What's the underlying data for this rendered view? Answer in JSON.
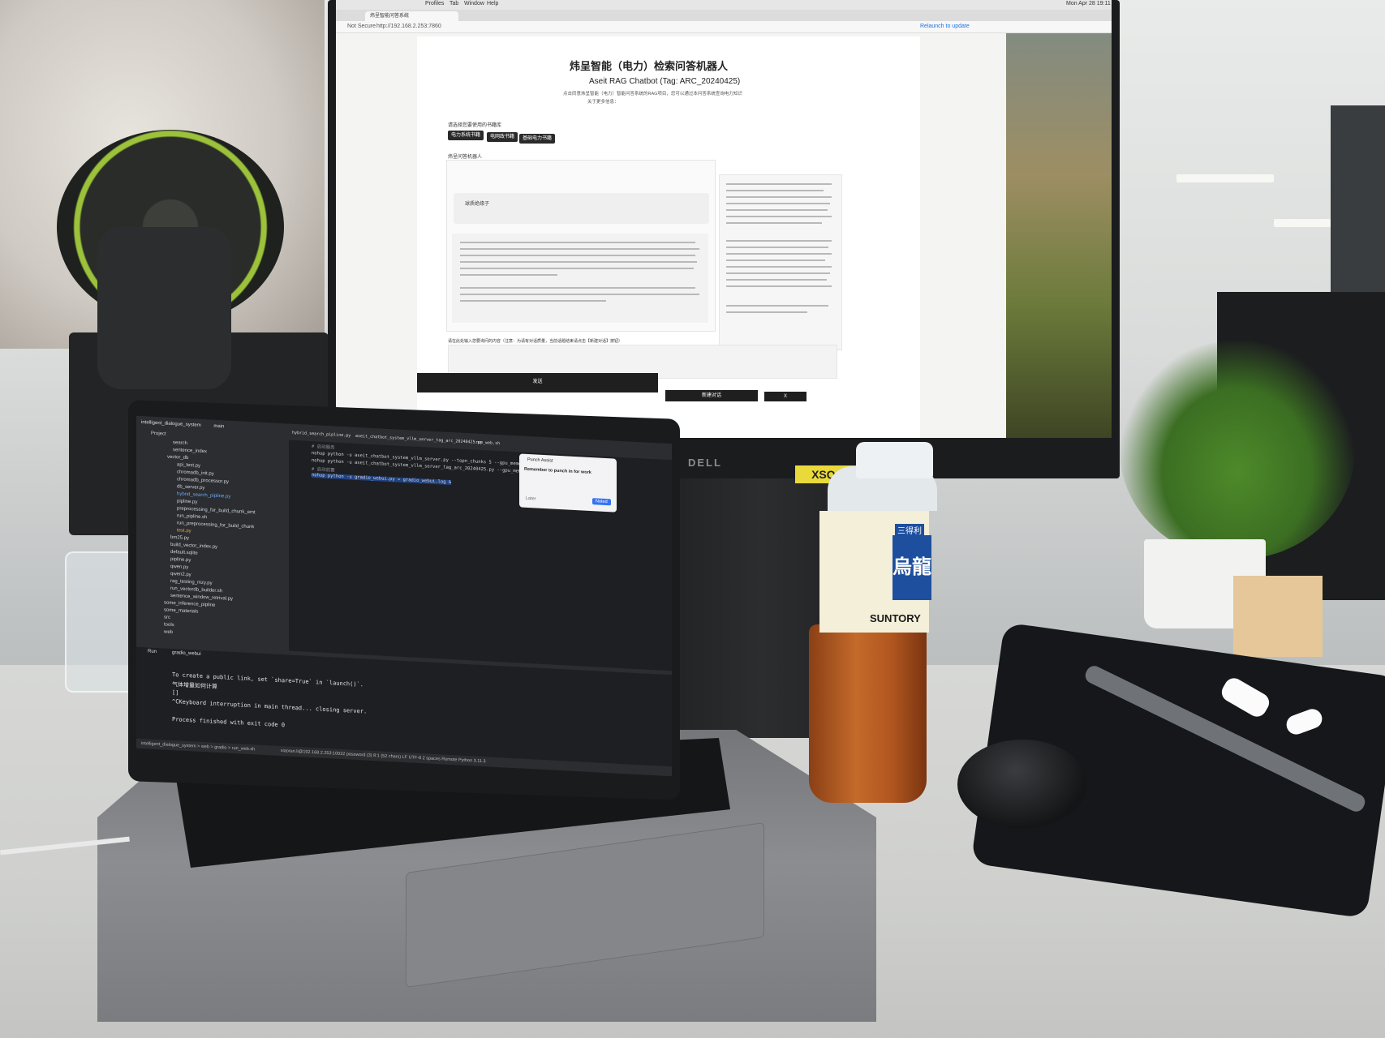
{
  "browser": {
    "menu_items": [
      "Profiles",
      "Tab",
      "Window",
      "Help"
    ],
    "tab_title": "炜呈智能问答系统",
    "not_secure": "Not Secure",
    "url": "http://192.168.2.253:7860",
    "relaunch": "Relaunch to update",
    "clock": "Mon Apr 28 19:11"
  },
  "app": {
    "title": "炜呈智能（电力）检索问答机器人",
    "subtitle": "Aseit RAG Chatbot (Tag: ARC_20240425)",
    "intro": "点击同意炜呈智能（电力）智能问答系统的RAG项目，您可以通过本问答系统查询电力知识",
    "more_info": "关于更多信息：",
    "kb_label": "请选择您要使用的书籍库",
    "kb_options": [
      "电力系统书籍",
      "电网政书籍",
      "基础电力书籍"
    ],
    "chat_label": "炜呈问答机器人",
    "user_message": "球质绝缘子",
    "input_label": "请在此处输入您要询问的内容（注意：为请有对话质量，当前话题结束请点击【新建对话】按钮）",
    "send_button": "发送",
    "new_chat_button": "新建对话",
    "x_button": "X"
  },
  "monitor": {
    "brand": "DELL",
    "asset_tag": "XSQ-62"
  },
  "ide": {
    "project": "intelligent_dialogue_system",
    "branch": "main",
    "project_label": "Project",
    "tree": [
      "search",
      "sentence_index",
      "vector_db",
      "api_test.py",
      "chromadb_init.py",
      "chromadb_processor.py",
      "db_server.py",
      "hybrid_search_pipline.py",
      "pipline.py",
      "preprocessing_for_build_chunk_emt",
      "run_pipline.sh",
      "run_preprocessing_for_build_chunk",
      "test.py",
      "bm25.py",
      "build_vector_index.py",
      "default.sqlite",
      "pipline.py",
      "qwen.py",
      "qwen2.py",
      "rag_testing_mzy.py",
      "run_vectordb_builder.sh",
      "sentence_window_retrival.py",
      "some_inference_pipline",
      "some_materials",
      "src",
      "tools",
      "web"
    ],
    "editor_tabs": [
      "hybrid_search_pipline.py",
      "aseit_chatbot_system_vllm_server_tag_arc_20240425.py",
      "run_web.sh"
    ],
    "code": [
      "# 启动服务",
      "nohup python -u aseit_chatbot_system_vllm_server.py --topn_chunks 5 --gpu_memory_uti",
      "nohup python -u aseit_chatbot_system_vllm_server_tag_arc_20240425.py --gpu_memory_uti",
      "# 启动前置",
      "nohup python -u gradio_webui.py > gradio_webui.log &"
    ],
    "popup": {
      "title": "Punch Assist",
      "message": "Remember to punch in for work",
      "button": "Noted",
      "later": "Later"
    },
    "run_label": "Run",
    "run_tab": "gradio_webui",
    "console": [
      "To create a public link, set `share=True` in `launch()`.",
      "气体增量如何计算",
      "[]",
      "^CKeyboard interruption in main thread... closing server.",
      "",
      "Process finished with exit code 0"
    ],
    "breadcrumb": "intelligent_dialogue_system > web > gradio > run_web.sh",
    "status": "xiaoran.li@192.168.2.253:10022 password (3)   8:1 (52 chars)   LF   UTF-8   2 spaces   Remote Python 3.11.3"
  },
  "bottle": {
    "brand_cn": "烏龍",
    "brand": "SUNTORY",
    "badge": "三得利"
  }
}
